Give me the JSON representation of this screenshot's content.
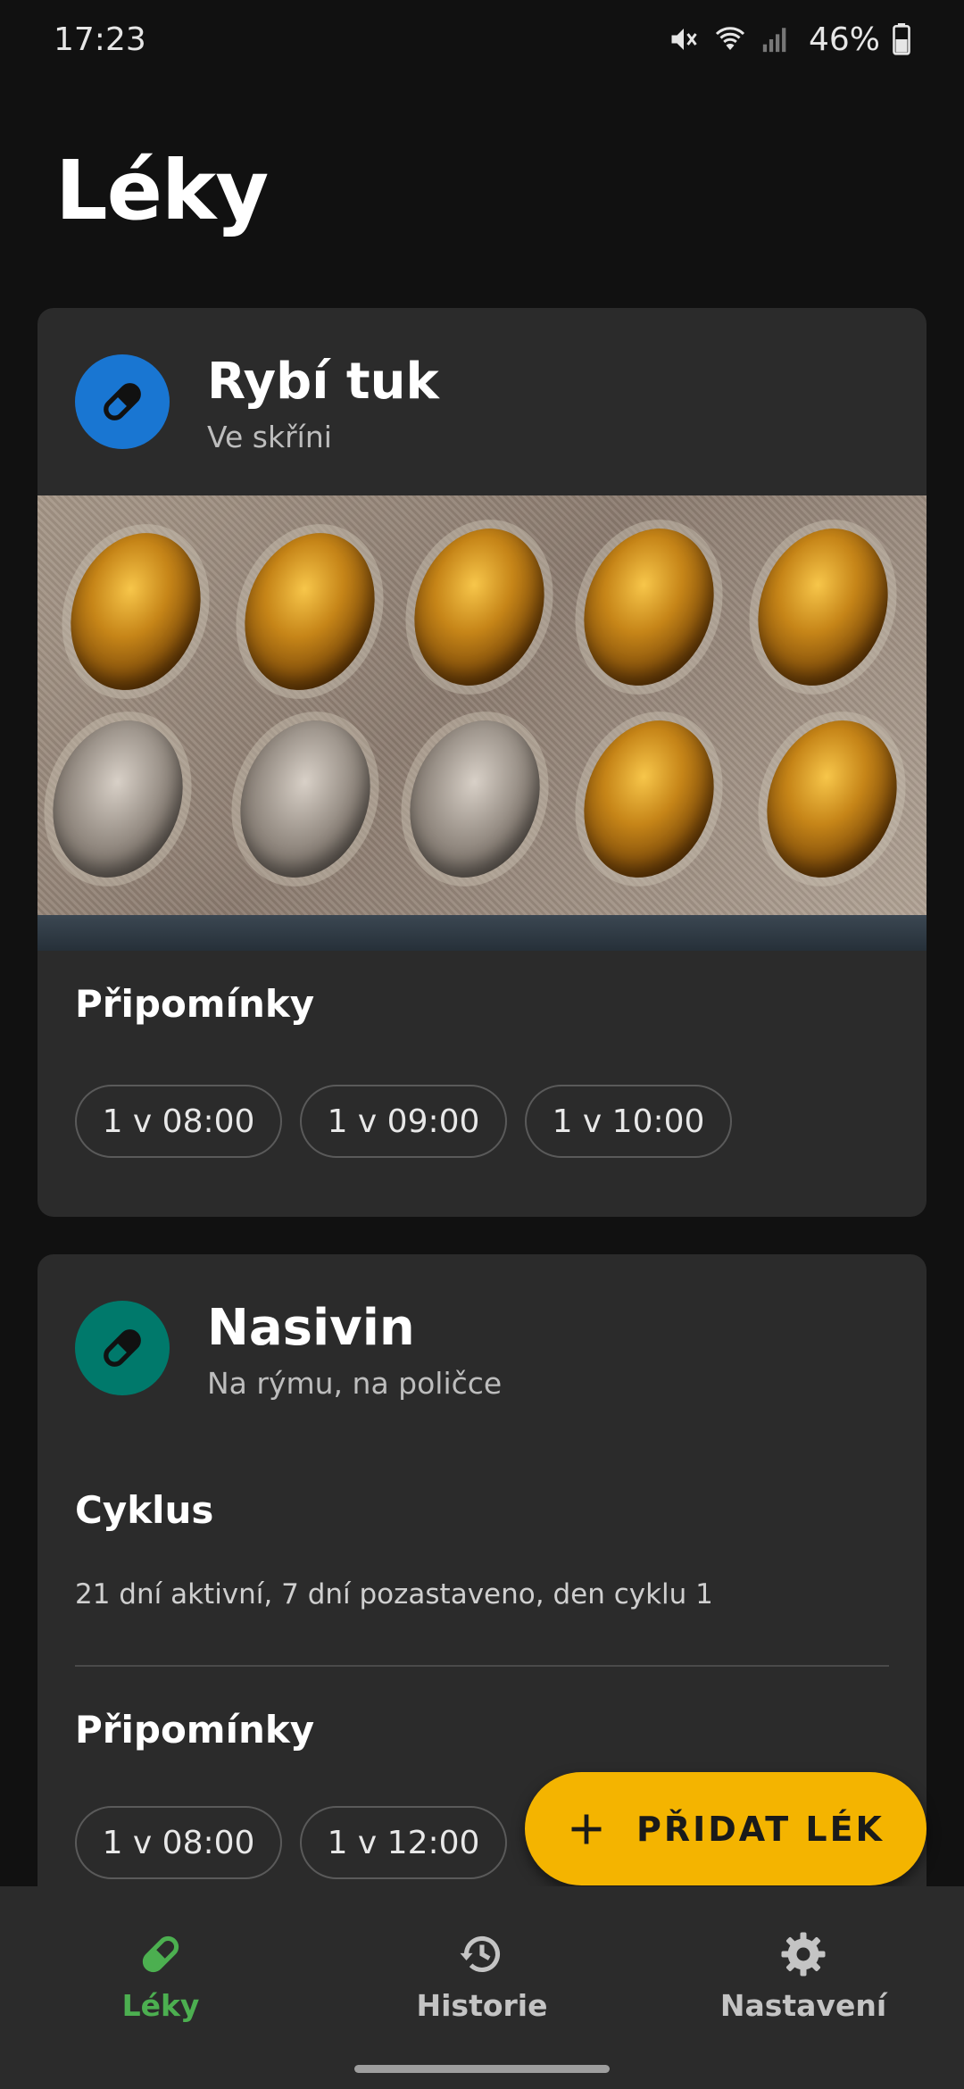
{
  "status_bar": {
    "time": "17:23",
    "battery": "46%"
  },
  "page": {
    "title": "Léky"
  },
  "medications": [
    {
      "name": "Rybí tuk",
      "subtitle": "Ve skříni",
      "avatar_color": "#1976d2",
      "icon": "pill-icon",
      "photo_description": "blister-pack-photo",
      "reminders_title": "Připomínky",
      "reminders": [
        "1 v 08:00",
        "1 v 09:00",
        "1 v 10:00"
      ]
    },
    {
      "name": "Nasivin",
      "subtitle": "Na rýmu, na poličce",
      "avatar_color": "#00796b",
      "icon": "pill-icon",
      "cycle_title": "Cyklus",
      "cycle_text": "21 dní aktivní, 7 dní pozastaveno, den cyklu 1",
      "reminders_title": "Připomínky",
      "reminders": [
        "1 v 08:00",
        "1 v 12:00"
      ]
    }
  ],
  "fab": {
    "label": "PŘIDAT LÉK",
    "icon": "plus-icon",
    "color": "#f4b400"
  },
  "bottom_nav": [
    {
      "label": "Léky",
      "icon": "pill-icon",
      "active": true
    },
    {
      "label": "Historie",
      "icon": "history-icon",
      "active": false
    },
    {
      "label": "Nastavení",
      "icon": "gear-icon",
      "active": false
    }
  ],
  "colors": {
    "accent_active": "#4caf50",
    "background": "#111111",
    "card": "#2b2b2b"
  }
}
